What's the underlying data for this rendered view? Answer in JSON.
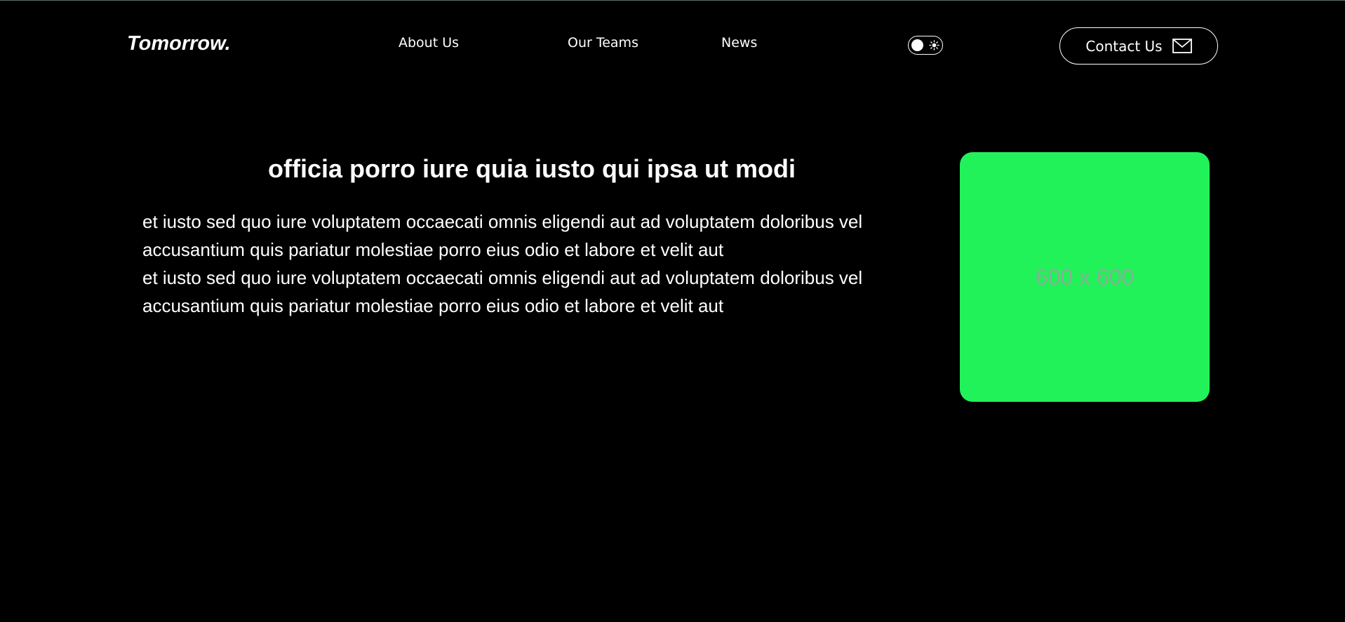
{
  "header": {
    "logo": "Tomorrow.",
    "nav": [
      {
        "label": "About Us"
      },
      {
        "label": "Our Teams"
      },
      {
        "label": "News"
      }
    ],
    "theme_toggle": {
      "state": "dark",
      "icon": "sun-icon"
    },
    "contact_button": {
      "label": "Contact Us",
      "icon": "mail-icon"
    }
  },
  "hero": {
    "title": "officia porro iure quia iusto qui ipsa ut modi",
    "paragraphs": [
      "et iusto sed quo iure voluptatem occaecati omnis eligendi aut ad voluptatem doloribus vel accusantium quis pariatur molestiae porro eius odio et labore et velit aut",
      "et iusto sed quo iure voluptatem occaecati omnis eligendi aut ad voluptatem doloribus vel accusantium quis pariatur molestiae porro eius odio et labore et velit aut"
    ],
    "image": {
      "label": "600 x 600",
      "background_color": "#22f25a"
    }
  },
  "colors": {
    "background": "#000000",
    "text": "#ffffff",
    "accent": "#22f25a"
  }
}
